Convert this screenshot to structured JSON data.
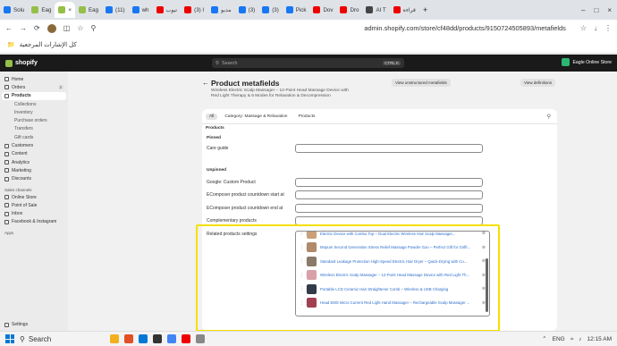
{
  "browser": {
    "tabs": [
      {
        "label": "Solu",
        "color": "#1877f2"
      },
      {
        "label": "Eag",
        "color": "#95bf47"
      },
      {
        "label": "",
        "color": "#95bf47",
        "active": true
      },
      {
        "label": "Eag",
        "color": "#95bf47"
      },
      {
        "label": "(11)",
        "color": "#1877f2"
      },
      {
        "label": "wh",
        "color": "#1877f2"
      },
      {
        "label": "تيوب",
        "color": "#e00"
      },
      {
        "label": "(3) I",
        "color": "#e00"
      },
      {
        "label": "مديو",
        "color": "#1877f2"
      },
      {
        "label": "(3)",
        "color": "#1877f2"
      },
      {
        "label": "(3)",
        "color": "#1877f2"
      },
      {
        "label": "Pick",
        "color": "#1877f2"
      },
      {
        "label": "Dov",
        "color": "#e00"
      },
      {
        "label": "Dro",
        "color": "#e00"
      },
      {
        "label": "AI T",
        "color": "#444"
      },
      {
        "label": "قراءة",
        "color": "#e00"
      }
    ],
    "new_tab": "+",
    "url": "admin.shopify.com/store/cf48dd/products/9150724505893/metafields",
    "bookmark": "كل الإشارات المرجعية"
  },
  "shopify": {
    "brand": "shopify",
    "search_placeholder": "Search",
    "search_shortcut": "CTRL K",
    "store_name": "Eagle Online Store"
  },
  "sidebar": {
    "items": [
      {
        "label": "Home",
        "sub": false
      },
      {
        "label": "Orders",
        "sub": false,
        "badge": "2"
      },
      {
        "label": "Products",
        "sub": false,
        "active": true
      },
      {
        "label": "Collections",
        "sub": true
      },
      {
        "label": "Inventory",
        "sub": true
      },
      {
        "label": "Purchase orders",
        "sub": true
      },
      {
        "label": "Transfers",
        "sub": true
      },
      {
        "label": "Gift cards",
        "sub": true
      },
      {
        "label": "Customers",
        "sub": false
      },
      {
        "label": "Content",
        "sub": false
      },
      {
        "label": "Analytics",
        "sub": false
      },
      {
        "label": "Marketing",
        "sub": false
      },
      {
        "label": "Discounts",
        "sub": false
      }
    ],
    "channels_title": "Sales channels",
    "channels": [
      "Online Store",
      "Point of Sale",
      "Inbox",
      "Facebook & Instagram"
    ],
    "apps_title": "Apps",
    "settings": "Settings"
  },
  "page": {
    "title": "Product metafields",
    "subtitle": "Wireless Electric Scalp Massager – 12-Point Head Massage Device with Red Light Therapy & 6 Modes for Relaxation & Decompression",
    "btn_unstructured": "View unstructured metafields",
    "btn_definitions": "View definitions",
    "filters": [
      "All",
      "Category: Massage & Relaxation",
      "Products"
    ],
    "section_products": "Products",
    "pinned_title": "Pinned",
    "pinned_fields": [
      "Care guide"
    ],
    "unpinned_title": "Unpinned",
    "unpinned_fields": [
      "Google: Custom Product",
      "EComposer product countdown start at",
      "EComposer product countdown end at",
      "Complementary products"
    ],
    "related_label": "Related products settings",
    "related_items": [
      {
        "name": "Electric Device with Combo Top – Dual Electric Wireless Hair Scalp Massager...",
        "color": "#c9a079"
      },
      {
        "name": "Mopum Second Generation Stress Relief Massage Powder Gun – Perfect Gift for Girlfr...",
        "color": "#b08a6a"
      },
      {
        "name": "Standard Leakage Protection High-Speed Electric Hair Dryer – Quick-Drying with Co...",
        "color": "#8a7a6a"
      },
      {
        "name": "Wireless Electric Scalp Massager – 12-Point Head Massage Device with Red Light Th...",
        "color": "#d8a0a8"
      },
      {
        "name": "Portable LCD Ceramic Hair Straightener Comb – Wireless & USB Charging",
        "color": "#333a4a"
      },
      {
        "name": "Head EMS Micro Current Red Light Hand Massager – Rechargeable Scalp Massager ...",
        "color": "#a04050"
      }
    ]
  },
  "taskbar": {
    "search": "Search",
    "lang": "ENG",
    "time": "12:15 AM"
  }
}
